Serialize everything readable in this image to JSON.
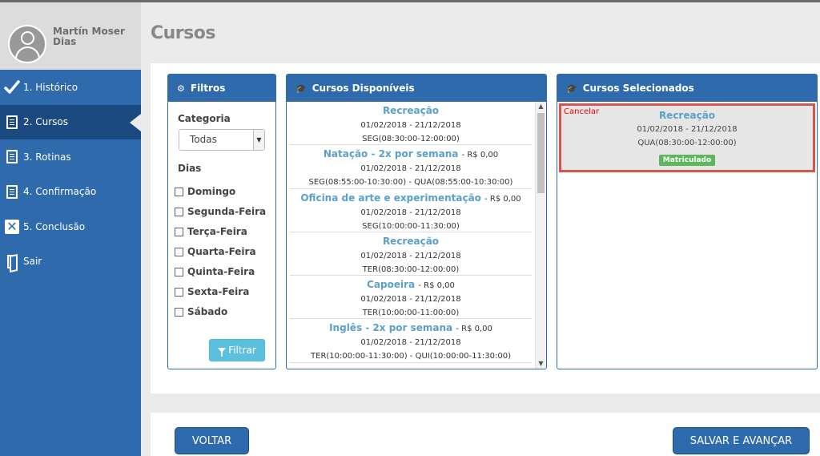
{
  "page": {
    "title": "Cursos"
  },
  "profile": {
    "name": "Martín Moser Dias"
  },
  "sidebar": {
    "items": [
      {
        "label": "1. Histórico",
        "icon": "check-icon"
      },
      {
        "label": "2. Cursos",
        "icon": "document-icon",
        "active": true
      },
      {
        "label": "3. Rotinas",
        "icon": "document-icon"
      },
      {
        "label": "4. Confirmação",
        "icon": "document-icon"
      },
      {
        "label": "5. Conclusão",
        "icon": "close-box-icon"
      },
      {
        "label": "Sair",
        "icon": "door-exit-icon"
      }
    ]
  },
  "filters": {
    "title": "Filtros",
    "category_label": "Categoria",
    "category_value": "Todas",
    "days_label": "Dias",
    "days": [
      "Domingo",
      "Segunda-Feira",
      "Terça-Feira",
      "Quarta-Feira",
      "Quinta-Feira",
      "Sexta-Feira",
      "Sábado"
    ],
    "button": "Filtrar"
  },
  "available": {
    "title": "Cursos Disponíveis",
    "courses": [
      {
        "name": "Recreação",
        "price": "",
        "dates": "01/02/2018 - 21/12/2018",
        "schedule": "SEG(08:30:00-12:00:00)"
      },
      {
        "name": "Natação - 2x por semana",
        "price": "- R$ 0,00",
        "dates": "01/02/2018 - 21/12/2018",
        "schedule": "SEG(08:55:00-10:30:00) - QUA(08:55:00-10:30:00)"
      },
      {
        "name": "Oficina de arte e experimentação",
        "price": "- R$ 0,00",
        "dates": "01/02/2018 - 21/12/2018",
        "schedule": "SEG(10:00:00-11:30:00)"
      },
      {
        "name": "Recreação",
        "price": "",
        "dates": "01/02/2018 - 21/12/2018",
        "schedule": "TER(08:30:00-12:00:00)"
      },
      {
        "name": "Capoeira",
        "price": "- R$ 0,00",
        "dates": "01/02/2018 - 21/12/2018",
        "schedule": "TER(10:00:00-11:00:00)"
      },
      {
        "name": "Inglês - 2x por semana",
        "price": "- R$ 0,00",
        "dates": "01/02/2018 - 21/12/2018",
        "schedule": "TER(10:00:00-11:30:00) - QUI(10:00:00-11:30:00)"
      }
    ]
  },
  "selected": {
    "title": "Cursos Selecionados",
    "course": {
      "cancel": "Cancelar",
      "name": "Recreação",
      "dates": "01/02/2018 - 21/12/2018",
      "schedule": "QUA(08:30:00-12:00:00)",
      "status": "Matriculado"
    }
  },
  "footer": {
    "back": "VOLTAR",
    "next": "SALVAR E AVANÇAR"
  },
  "colors": {
    "primary": "#2e6aac",
    "active_nav": "#1b4a80",
    "course_name": "#5aa0c8",
    "filter_button": "#5bc0de",
    "badge": "#5cb85c",
    "highlight_border": "#d9534f"
  }
}
